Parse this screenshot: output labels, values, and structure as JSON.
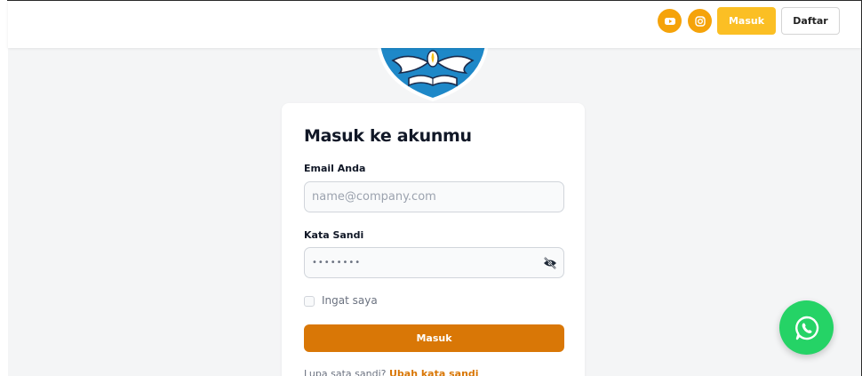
{
  "nav": {
    "social": [
      {
        "icon": "youtube-icon"
      },
      {
        "icon": "instagram-icon"
      }
    ],
    "login_label": "Masuk",
    "register_label": "Daftar"
  },
  "login": {
    "title": "Masuk ke akunmu",
    "email": {
      "label": "Email Anda",
      "placeholder": "name@company.com",
      "value": ""
    },
    "password": {
      "label": "Kata Sandi",
      "value": "••••••••"
    },
    "remember_label": "Ingat saya",
    "submit_label": "Masuk",
    "forgot_text": "Lupa sata sandi?",
    "forgot_link": "Ubah kata sandi"
  },
  "floating": {
    "icon": "whatsapp-icon"
  },
  "colors": {
    "accent_yellow": "#fbbf24",
    "social_orange": "#f5a30a",
    "primary_orange": "#d97706",
    "whatsapp_green": "#25d366",
    "logo_blue": "#1e88c8"
  }
}
